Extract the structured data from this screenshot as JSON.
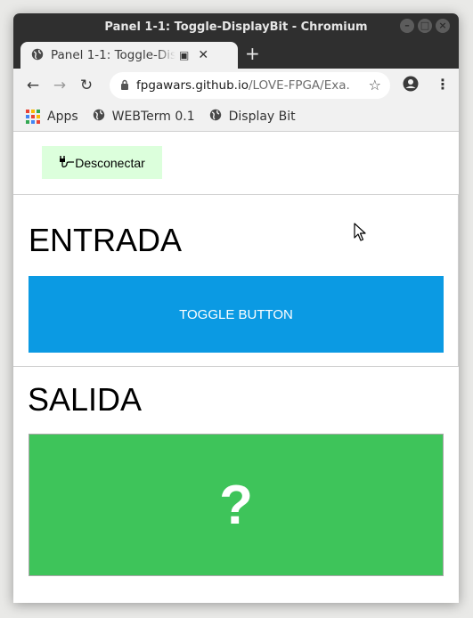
{
  "window": {
    "title": "Panel 1-1: Toggle-DisplayBit - Chromium"
  },
  "tab": {
    "title": "Panel 1-1: Toggle-DisplayBit",
    "icon": "globe-icon"
  },
  "toolbar": {
    "url_host": "fpgawars.github.io",
    "url_path": "/LOVE-FPGA/Exa..."
  },
  "bookmarks": [
    {
      "label": "Apps",
      "icon": "apps-icon"
    },
    {
      "label": "WEBTerm 0.1",
      "icon": "globe-icon"
    },
    {
      "label": "Display Bit",
      "icon": "globe-icon"
    }
  ],
  "page": {
    "disconnect_label": "Desconectar",
    "input_heading": "ENTRADA",
    "toggle_label": "TOGGLE BUTTON",
    "output_heading": "SALIDA",
    "display_value": "?"
  },
  "colors": {
    "toggle": "#0b9ae3",
    "display": "#3ec45a",
    "disconnect_bg": "#dcffdc"
  }
}
